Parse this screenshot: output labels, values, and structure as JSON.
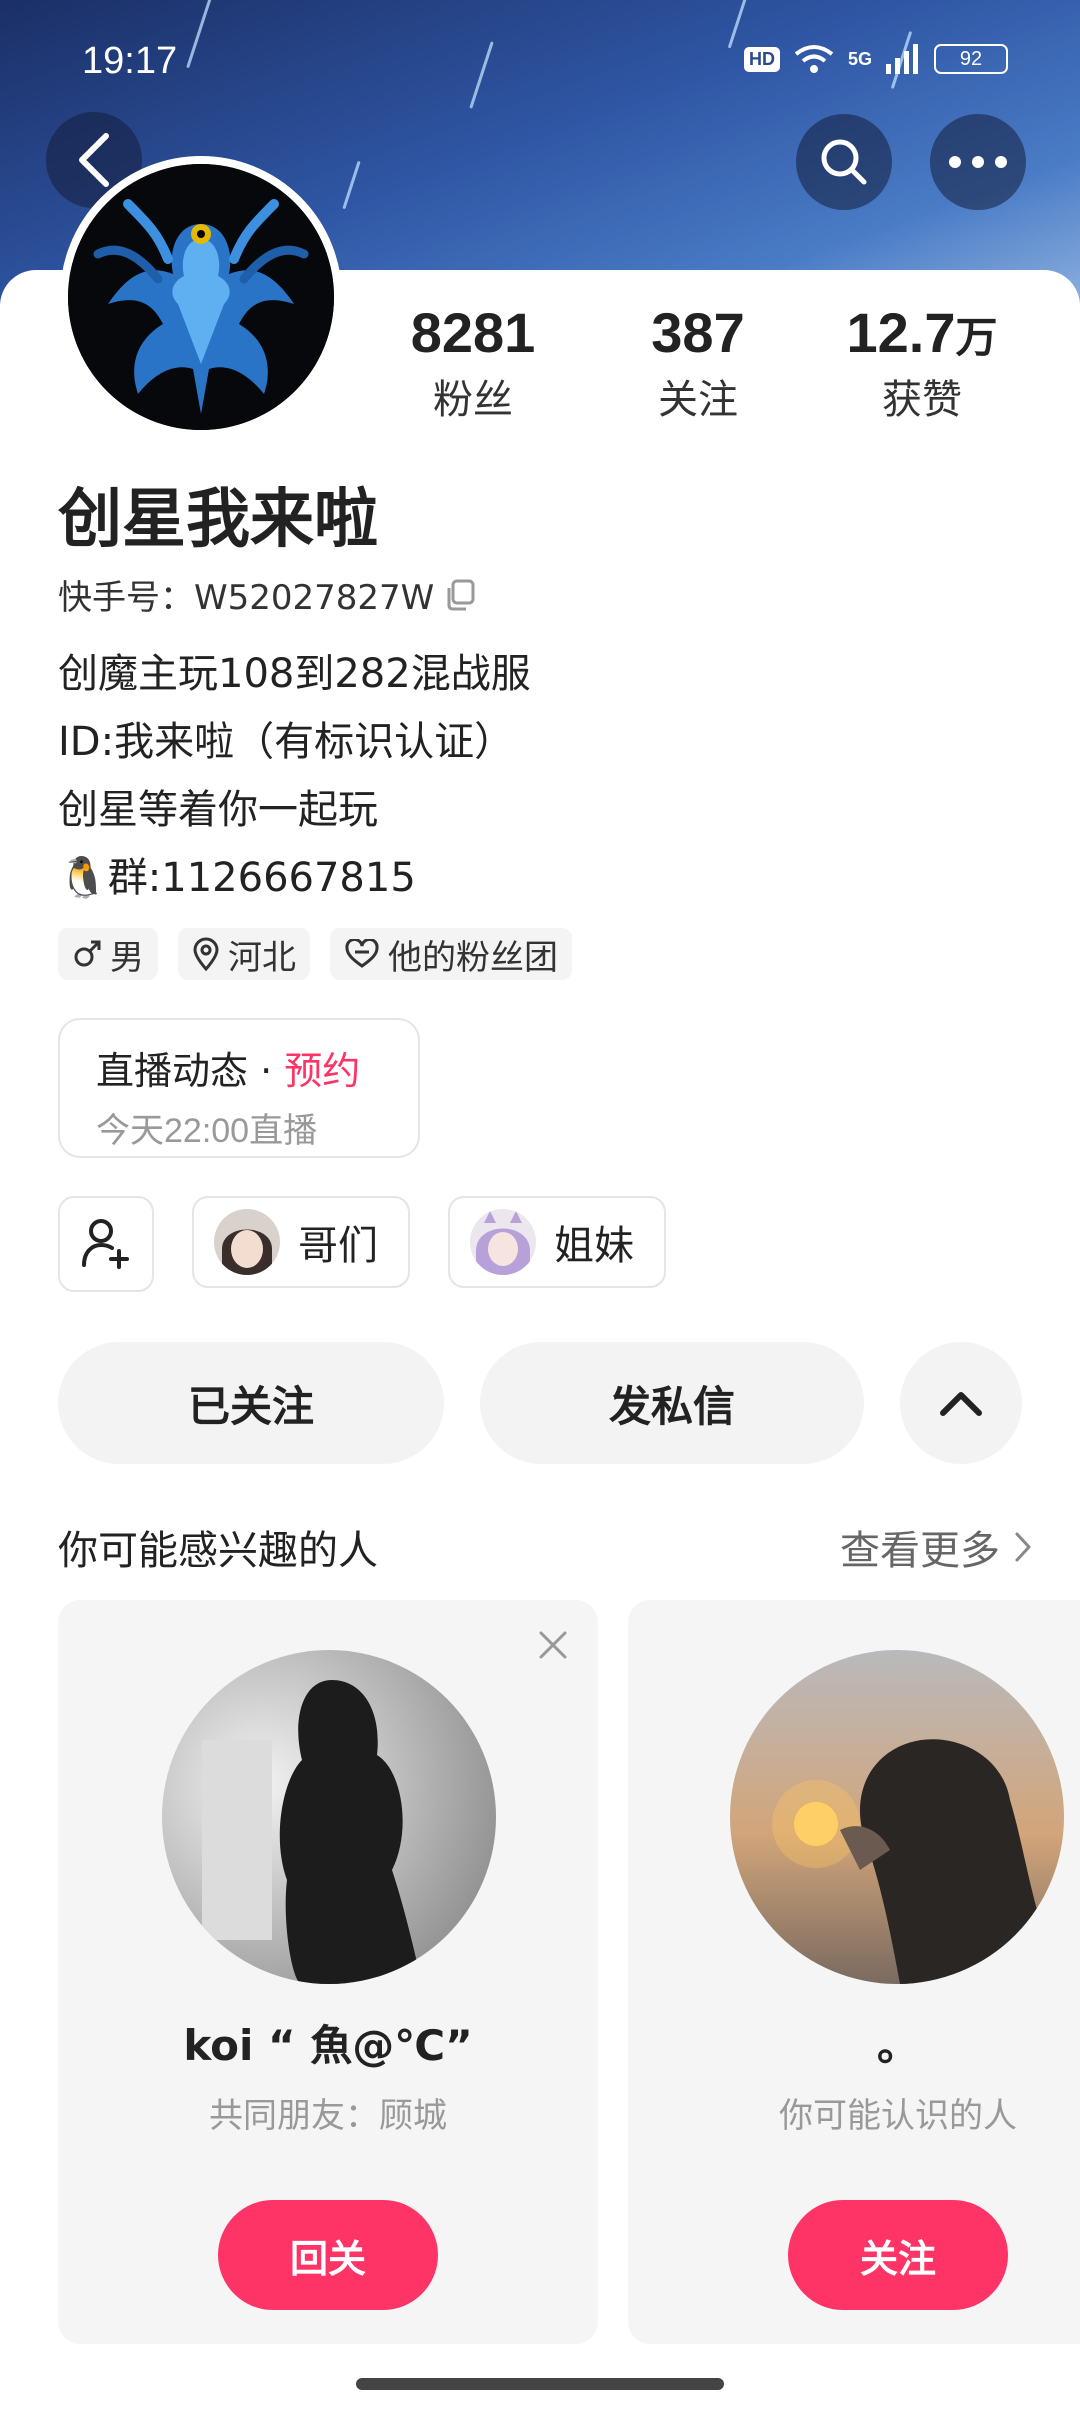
{
  "status_bar": {
    "time": "19:17",
    "hd_badge": "HD",
    "network": "5G",
    "battery": "92"
  },
  "header": {
    "back_icon": "chevron-left-icon",
    "search_icon": "search-icon",
    "more_icon": "more-dots-icon"
  },
  "stats": [
    {
      "value": "8281",
      "unit": "",
      "label": "粉丝"
    },
    {
      "value": "387",
      "unit": "",
      "label": "关注"
    },
    {
      "value": "12.7",
      "unit": "万",
      "label": "获赞"
    }
  ],
  "profile": {
    "name": "创星我来啦",
    "kuaishou_id": "快手号：W52027827W",
    "bio": [
      "创魔主玩108到282混战服",
      "ID:我来啦（有标识认证）",
      "创星等着你一起玩",
      "🐧群:1126667815"
    ],
    "tags": [
      {
        "icon": "male-icon",
        "label": "男"
      },
      {
        "icon": "location-pin-icon",
        "label": "河北"
      },
      {
        "icon": "heart-badge-icon",
        "label": "他的粉丝团"
      }
    ]
  },
  "live": {
    "title": "直播动态 · ",
    "reserve": "预约",
    "time": "今天22:00直播"
  },
  "groups": [
    {
      "label": "哥们"
    },
    {
      "label": "姐妹"
    }
  ],
  "actions": {
    "followed": "已关注",
    "message": "发私信"
  },
  "suggest": {
    "title": "你可能感兴趣的人",
    "more": "查看更多",
    "cards": [
      {
        "name": "koi “ 魚@℃”",
        "sub": "共同朋友：顾城",
        "button": "回关"
      },
      {
        "name": "。",
        "sub": "你可能认识的人",
        "button": "关注"
      }
    ]
  },
  "colors": {
    "accent": "#fe3466",
    "header_blue": "#2f56a4"
  }
}
